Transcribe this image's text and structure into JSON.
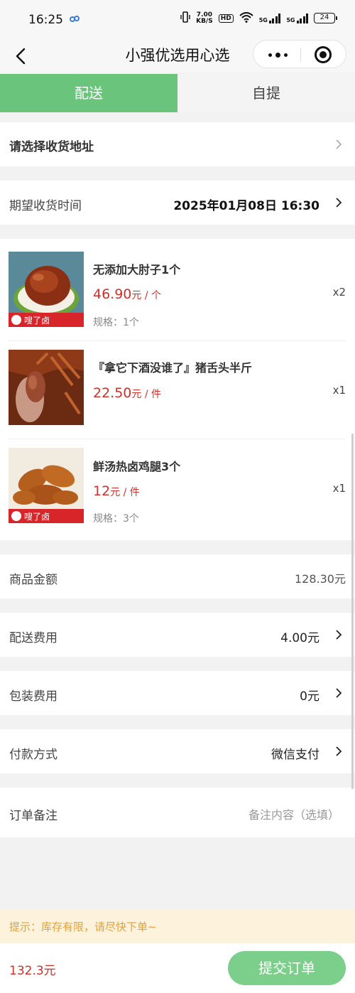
{
  "status_bar": {
    "time": "16:25",
    "speed_value": "7.00",
    "speed_unit": "KB/S",
    "hd_badge": "HD",
    "net_1": "5G",
    "net_2": "5G",
    "battery": "24"
  },
  "nav": {
    "title": "小强优选用心选"
  },
  "tabs": [
    {
      "label": "配送",
      "active": true
    },
    {
      "label": "自提",
      "active": false
    }
  ],
  "address": {
    "label": "请选择收货地址"
  },
  "delivery_time": {
    "label": "期望收货时间",
    "value": "2025年01月08日 16:30"
  },
  "products": [
    {
      "name": "无添加大肘子1个",
      "price": "46.90",
      "unit": "元 / 个",
      "spec": "规格：1个",
      "qty": "x2",
      "brand": "嗖了卤"
    },
    {
      "name": "『拿它下酒没谁了』猪舌头半斤",
      "price": "22.50",
      "unit": "元 / 件",
      "spec": "",
      "qty": "x1"
    },
    {
      "name": "鲜汤热卤鸡腿3个",
      "price": "12",
      "unit": "元 / 件",
      "spec": "规格：3个",
      "qty": "x1",
      "brand": "嗖了卤"
    }
  ],
  "summary": {
    "goods_amount": {
      "label": "商品金额",
      "value": "128.30元"
    },
    "delivery_fee": {
      "label": "配送费用",
      "value": "4.00元"
    },
    "packing_fee": {
      "label": "包装费用",
      "value": "0元"
    },
    "payment": {
      "label": "付款方式",
      "value": "微信支付"
    },
    "remark": {
      "label": "订单备注",
      "placeholder": "备注内容（选填）"
    }
  },
  "tip": "提示：库存有限，请尽快下单~",
  "bottom": {
    "total": "132.3元",
    "submit_label": "提交订单"
  },
  "colors": {
    "accent_green": "#6bc47c",
    "price_red": "#d0302a",
    "tip_orange": "#e3a23c"
  },
  "icons": [
    "back-arrow-icon",
    "more-dots-icon",
    "close-circle-icon",
    "chevron-right-icon"
  ]
}
